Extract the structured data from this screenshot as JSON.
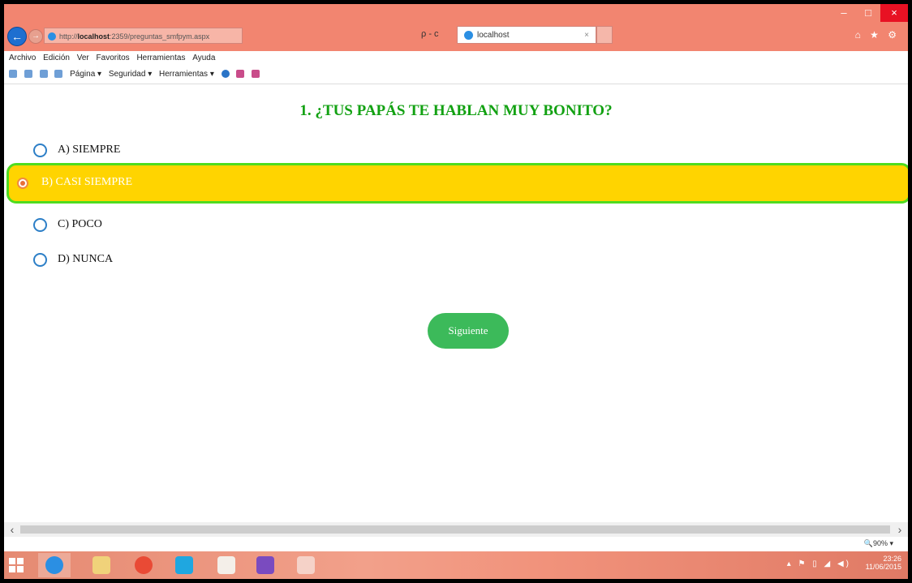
{
  "browser": {
    "url_prefix": "http://",
    "url_host": "localhost",
    "url_rest": ":2359/preguntas_smfpym.aspx",
    "addr_tools": "ρ - c",
    "tab_title": "localhost",
    "tab_close": "×",
    "window_controls": [
      "–",
      "□",
      "×"
    ],
    "right_icons": "⌂ ★ ⚙",
    "menu": [
      "Archivo",
      "Edición",
      "Ver",
      "Favoritos",
      "Herramientas",
      "Ayuda"
    ],
    "commands": [
      "Página ▾",
      "Seguridad ▾",
      "Herramientas ▾"
    ]
  },
  "question": {
    "title": "1. ¿TUS PAPÁS TE HABLAN MUY BONITO?",
    "options": [
      {
        "label": "A) SIEMPRE",
        "selected": false
      },
      {
        "label": "B) CASI SIEMPRE",
        "selected": true
      },
      {
        "label": "C) POCO",
        "selected": false
      },
      {
        "label": "D) NUNCA",
        "selected": false
      }
    ],
    "next_button": "Siguiente"
  },
  "statusbar": {
    "zoom": "🔍90%  ▾"
  },
  "taskbar": {
    "time": "23:26",
    "date": "11/06/2015",
    "tray": "▴ ⚑ ▯ ◢ ◀)"
  },
  "colors": {
    "accent_green": "#12a112",
    "selected_bg": "#ffd400",
    "selected_border": "#4fdc1f",
    "button_bg": "#3cba5a",
    "titlebar": "#f28570"
  }
}
